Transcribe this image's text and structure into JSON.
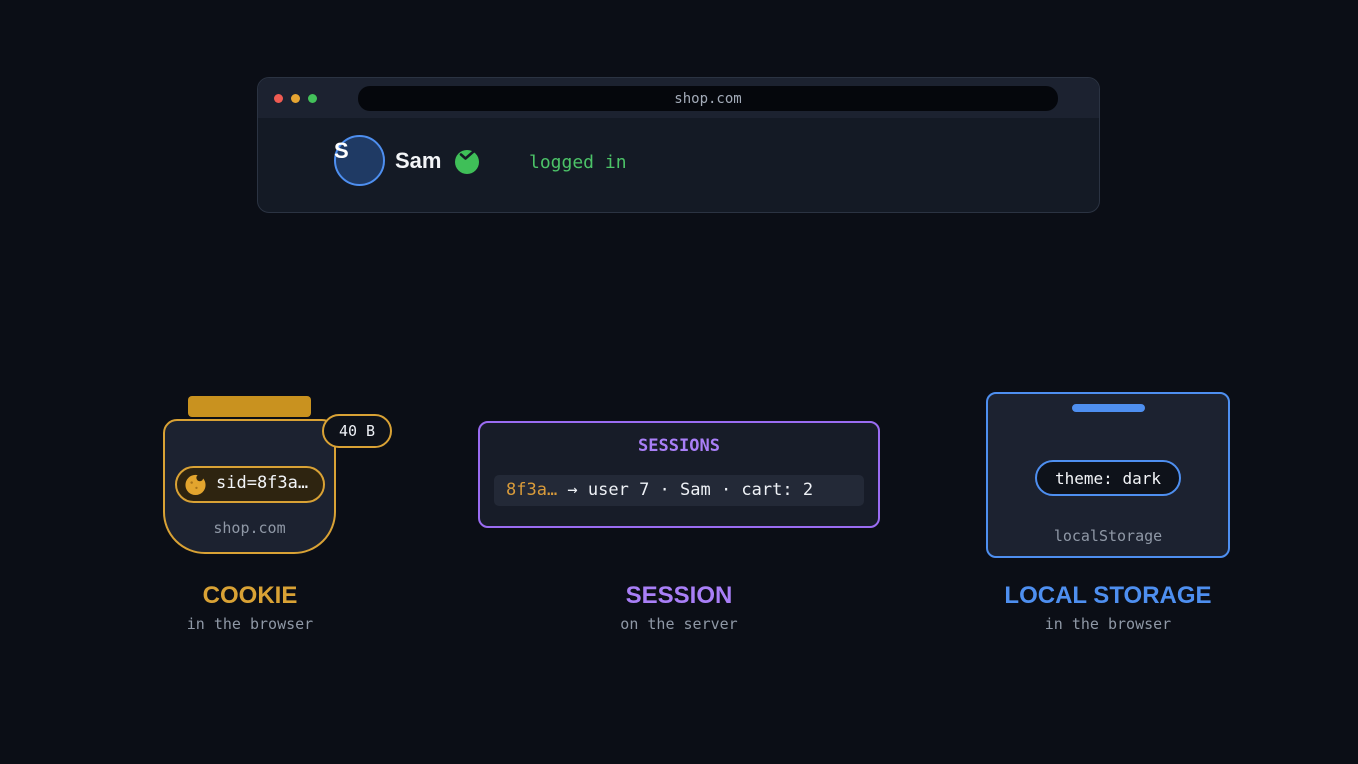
{
  "browser": {
    "url": "shop.com",
    "user": {
      "initial": "S",
      "name": "Sam",
      "status": "logged in"
    }
  },
  "cookie": {
    "size_badge": "40 B",
    "value": "sid=8f3a…",
    "domain": "shop.com",
    "title": "COOKIE",
    "subtitle": "in the browser",
    "icon": "cookie-icon"
  },
  "session": {
    "header": "SESSIONS",
    "row": {
      "id": "8f3a…",
      "details": " → user 7 · Sam · cart: 2"
    },
    "title": "SESSION",
    "subtitle": "on the server"
  },
  "local_storage": {
    "value": "theme: dark",
    "name": "localStorage",
    "title": "LOCAL STORAGE",
    "subtitle": "in the browser"
  },
  "colors": {
    "background": "#0b0e16",
    "cookie_accent": "#d9a235",
    "session_accent": "#9a6cf2",
    "storage_accent": "#4e8ff0",
    "status_green": "#4cc368"
  }
}
